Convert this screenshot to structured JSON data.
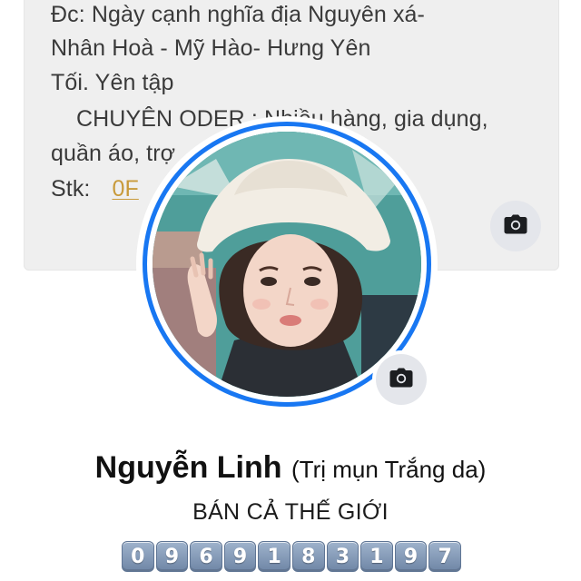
{
  "cover": {
    "lines": [
      "Đc:  Ngày cạnh nghĩa địa Nguyên xá-",
      "Nhân Hoà - Mỹ Hào- Hưng Yên",
      "Tối. Yên tập",
      "CHUYÊN ODER : Nhiều hàng, gia dụng,",
      "quần áo, trợ",
      "Stk:"
    ],
    "stk_value": "0F"
  },
  "profile": {
    "name": "Nguyễn Linh",
    "nickname": "(Trị mụn Trắng da)",
    "bio": "BÁN CẢ THẾ GIỚI",
    "phone_digits": [
      "0",
      "9",
      "6",
      "9",
      "1",
      "8",
      "3",
      "1",
      "9",
      "7"
    ]
  },
  "icons": {
    "cover_camera": "camera-icon",
    "avatar_camera": "camera-icon"
  },
  "colors": {
    "ring": "#1877f2",
    "cover_bg": "#efefef",
    "camera_btn_bg": "#e4e6eb",
    "digit_tile": "#7f95b3"
  }
}
